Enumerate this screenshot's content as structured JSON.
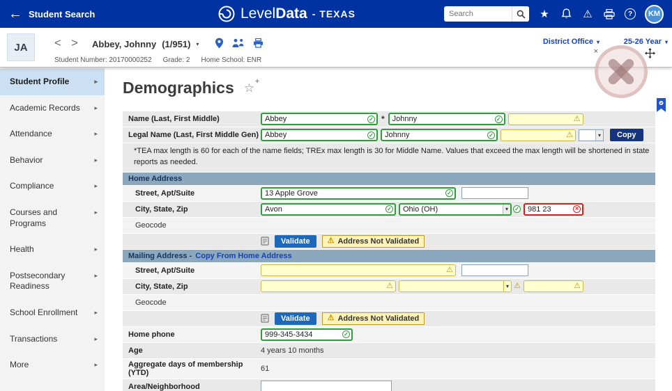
{
  "topbar": {
    "back_label": "Student Search",
    "brand_level": "Level",
    "brand_data": "Data",
    "brand_region": "- TEXAS",
    "search_placeholder": "Search",
    "user_initials": "KM"
  },
  "studentbar": {
    "avatar_initials": "JA",
    "student_name": "Abbey, Johnny",
    "student_count": "(1/951)",
    "meta_student": "Student Number: 20170000252",
    "meta_grade": "Grade: 2",
    "meta_school": "Home School: ENR",
    "district": "District Office",
    "year": "25-26 Year"
  },
  "sidebar": {
    "items": [
      {
        "label": "Student Profile"
      },
      {
        "label": "Academic Records"
      },
      {
        "label": "Attendance"
      },
      {
        "label": "Behavior"
      },
      {
        "label": "Compliance"
      },
      {
        "label": "Courses and Programs"
      },
      {
        "label": "Health"
      },
      {
        "label": "Postsecondary Readiness"
      },
      {
        "label": "School Enrollment"
      },
      {
        "label": "Transactions"
      },
      {
        "label": "More"
      }
    ]
  },
  "main": {
    "title": "Demographics"
  },
  "form": {
    "name": {
      "label": "Name (Last, First Middle)",
      "last": "Abbey",
      "first": "Johnny",
      "middle": "",
      "separator": "*"
    },
    "legal": {
      "label": "Legal Name (Last, First Middle Gen)",
      "last": "Abbey",
      "first": "Johnny",
      "middle": "",
      "gen": "",
      "copy": "Copy"
    },
    "note": "*TEA max length is 60 for each of the name fields; TREx max length is 30 for Middle Name. Values that exceed the max length will be shortened in state reports as needed.",
    "home": {
      "header": "Home Address",
      "street_label": "Street, Apt/Suite",
      "street": "13 Apple Grove",
      "apt": "",
      "city_label": "City, State, Zip",
      "city": "Avon",
      "state": "Ohio (OH)",
      "zip": "981 23",
      "geocode_label": "Geocode",
      "validate": "Validate",
      "not_validated": "Address Not Validated"
    },
    "mailing": {
      "header": "Mailing Address -",
      "copy_link": "Copy From Home Address",
      "street_label": "Street, Apt/Suite",
      "street": "",
      "apt": "",
      "city_label": "City, State, Zip",
      "city": "",
      "state": "",
      "zip": "",
      "geocode_label": "Geocode",
      "validate": "Validate",
      "not_validated": "Address Not Validated"
    },
    "phone": {
      "label": "Home phone",
      "value": "999-345-3434"
    },
    "age": {
      "label": "Age",
      "value": "4 years 10 months"
    },
    "adm": {
      "label": "Aggregate days of membership (YTD)",
      "value": "61"
    },
    "area": {
      "label": "Area/Neighborhood",
      "value": ""
    }
  },
  "colors": {
    "topbar_blue": "#0033A1",
    "link_blue": "#1744C9",
    "valid_green": "#2E9E3A",
    "warning_bg": "#FFFFCF",
    "error_red": "#CC2222",
    "section_header": "#8CA8BE"
  }
}
